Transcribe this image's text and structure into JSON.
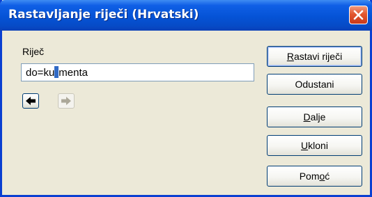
{
  "window": {
    "title": "Rastavljanje riječi (Hrvatski)",
    "titlebar_color": "#0553d6",
    "close_icon": "close-icon"
  },
  "word": {
    "label": "Riječ",
    "value_before": "do=ku",
    "value_after": "menta"
  },
  "navigation": {
    "back_icon": "arrow-left-icon",
    "forward_icon": "arrow-right-icon",
    "forward_enabled": false
  },
  "buttons": {
    "hyphenate": {
      "mnemonic": "R",
      "rest": "astavi riječi"
    },
    "cancel": {
      "label": "Odustani"
    },
    "next": {
      "mnemonic": "D",
      "rest": "alje"
    },
    "remove": {
      "mnemonic": "U",
      "rest": "kloni"
    },
    "help": {
      "before": "Pom",
      "mnemonic": "o",
      "after": "ć"
    }
  }
}
